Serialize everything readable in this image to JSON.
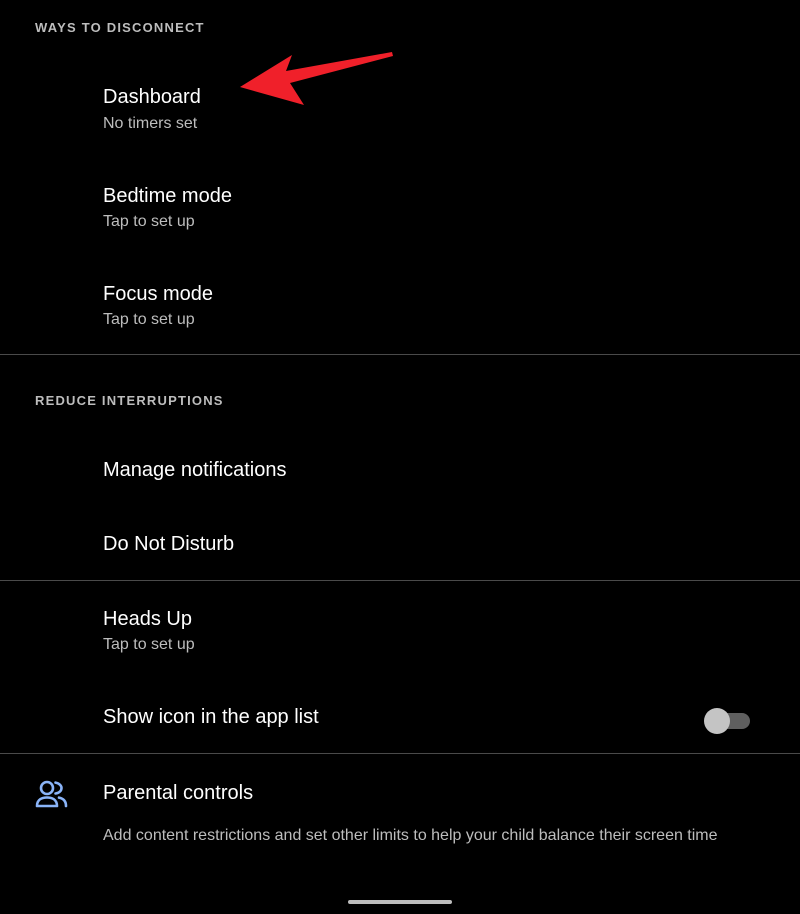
{
  "sections": {
    "ways_to_disconnect": "WAYS TO DISCONNECT",
    "reduce_interruptions": "REDUCE INTERRUPTIONS"
  },
  "items": {
    "dashboard": {
      "title": "Dashboard",
      "subtitle": "No timers set"
    },
    "bedtime": {
      "title": "Bedtime mode",
      "subtitle": "Tap to set up"
    },
    "focus": {
      "title": "Focus mode",
      "subtitle": "Tap to set up"
    },
    "notifications": {
      "title": "Manage notifications"
    },
    "dnd": {
      "title": "Do Not Disturb"
    },
    "heads_up": {
      "title": "Heads Up",
      "subtitle": "Tap to set up"
    },
    "show_icon": {
      "title": "Show icon in the app list",
      "toggle_on": false
    },
    "parental": {
      "title": "Parental controls",
      "description": "Add content restrictions and set other limits to help your child balance their screen time"
    }
  },
  "icons": {
    "parental": "people-icon",
    "annotation": "red-arrow-icon"
  },
  "colors": {
    "background": "#000000",
    "text_primary": "#ffffff",
    "text_secondary": "#bdbdbd",
    "divider": "#4a4a4a",
    "accent_icon": "#8ab4f8",
    "annotation_arrow": "#f0202a"
  }
}
